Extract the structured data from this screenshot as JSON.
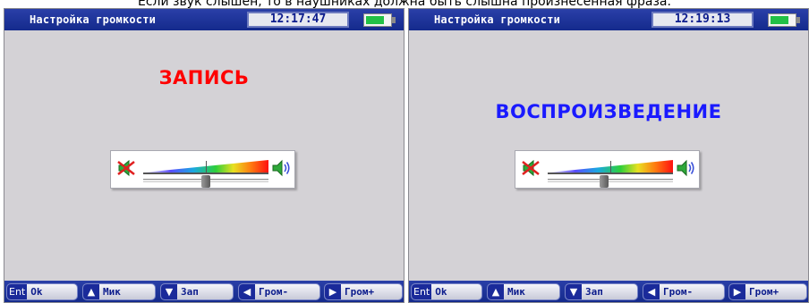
{
  "caption": "Если звук слышен, то в наушниках должна быть слышна произнесенная фраза.",
  "colors": {
    "bar_blue": "#1a2f9c",
    "screen_bg": "#d4d2d6",
    "record_red": "#ff0000",
    "playback_blue": "#1a1aff",
    "battery_green": "#22c046"
  },
  "screens": [
    {
      "title": "Настройка громкости",
      "time": "12:17:47",
      "mode_label": "ЗАПИСЬ",
      "volume_level": 0.5,
      "icons": {
        "mute": "speaker-muted-icon",
        "loud": "speaker-loud-icon",
        "battery": "battery-icon"
      },
      "softkeys": [
        {
          "key": "Ent",
          "label": "Ok"
        },
        {
          "key": "▲",
          "label": "Мик"
        },
        {
          "key": "▼",
          "label": "Зап"
        },
        {
          "key": "◀",
          "label": "Гром-"
        },
        {
          "key": "▶",
          "label": "Гром+"
        }
      ]
    },
    {
      "title": "Настройка громкости",
      "time": "12:19:13",
      "mode_label": "ВОСПРОИЗВЕДЕНИЕ",
      "volume_level": 0.45,
      "icons": {
        "mute": "speaker-muted-icon",
        "loud": "speaker-loud-icon",
        "battery": "battery-icon"
      },
      "softkeys": [
        {
          "key": "Ent",
          "label": "Ok"
        },
        {
          "key": "▲",
          "label": "Мик"
        },
        {
          "key": "▼",
          "label": "Зап"
        },
        {
          "key": "◀",
          "label": "Гром-"
        },
        {
          "key": "▶",
          "label": "Гром+"
        }
      ]
    }
  ]
}
